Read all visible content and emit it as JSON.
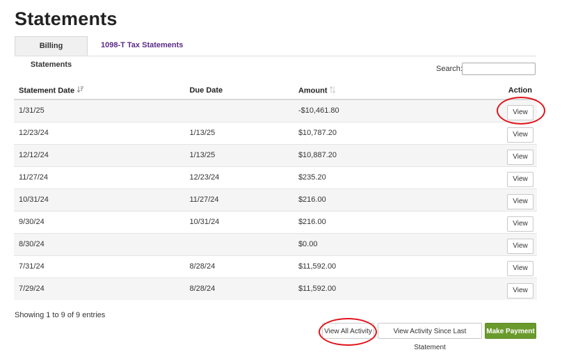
{
  "page": {
    "title": "Statements"
  },
  "tabs": [
    {
      "label": "Billing Statements",
      "active": true
    },
    {
      "label": "1098-T Tax Statements",
      "active": false
    }
  ],
  "search": {
    "label": "Search:",
    "value": "",
    "placeholder": ""
  },
  "table": {
    "columns": [
      "Statement Date",
      "Due Date",
      "Amount",
      "Action"
    ],
    "sort": {
      "column": "Statement Date",
      "direction": "descending"
    },
    "rows": [
      {
        "statement_date": "1/31/25",
        "due_date": "",
        "amount": "-$10,461.80",
        "action": "View"
      },
      {
        "statement_date": "12/23/24",
        "due_date": "1/13/25",
        "amount": "$10,787.20",
        "action": "View"
      },
      {
        "statement_date": "12/12/24",
        "due_date": "1/13/25",
        "amount": "$10,887.20",
        "action": "View"
      },
      {
        "statement_date": "11/27/24",
        "due_date": "12/23/24",
        "amount": "$235.20",
        "action": "View"
      },
      {
        "statement_date": "10/31/24",
        "due_date": "11/27/24",
        "amount": "$216.00",
        "action": "View"
      },
      {
        "statement_date": "9/30/24",
        "due_date": "10/31/24",
        "amount": "$216.00",
        "action": "View"
      },
      {
        "statement_date": "8/30/24",
        "due_date": "",
        "amount": "$0.00",
        "action": "View"
      },
      {
        "statement_date": "7/31/24",
        "due_date": "8/28/24",
        "amount": "$11,592.00",
        "action": "View"
      },
      {
        "statement_date": "7/29/24",
        "due_date": "8/28/24",
        "amount": "$11,592.00",
        "action": "View"
      }
    ]
  },
  "footer": {
    "showing": "Showing 1 to 9 of 9 entries",
    "view_all_activity": "View All Activity",
    "view_since_last": "View Activity Since Last Statement",
    "make_payment": "Make Payment"
  },
  "colors": {
    "tab_link": "#5b2a86",
    "payment_button": "#6b9a2c",
    "annotation": "#e0121a"
  }
}
